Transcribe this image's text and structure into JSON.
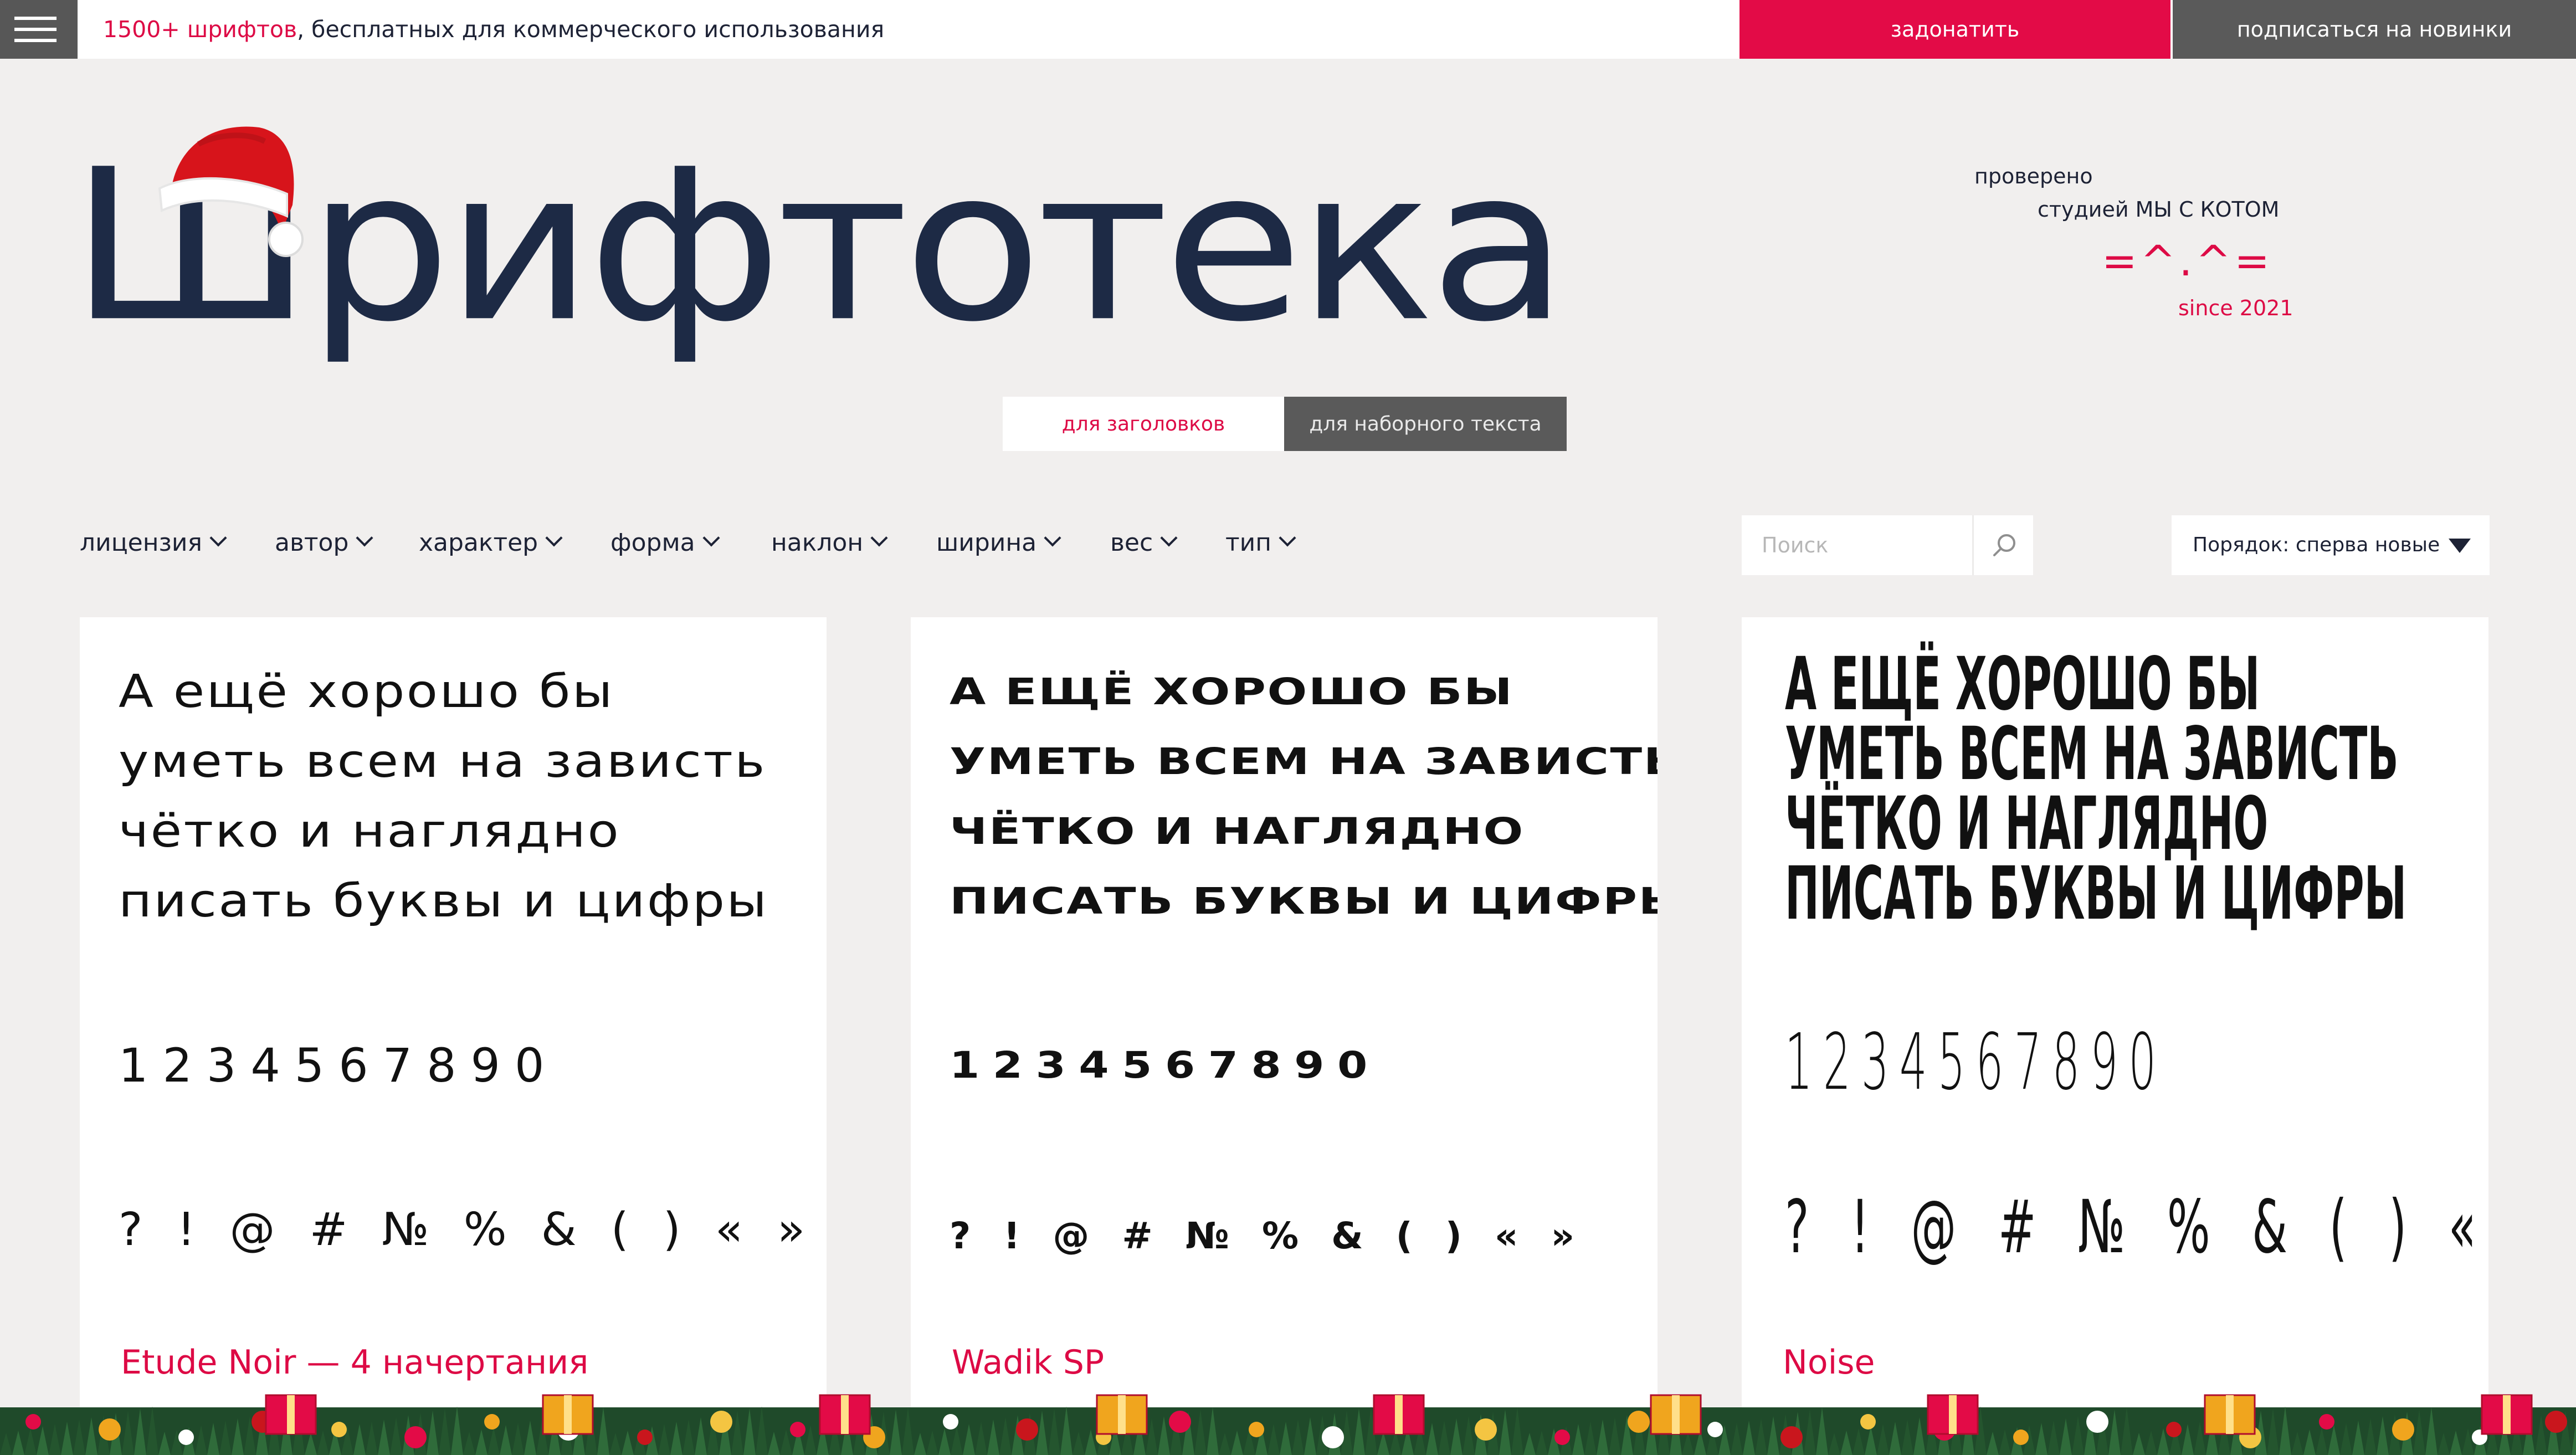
{
  "topbar": {
    "tagline_accent": "1500+ шрифтов",
    "tagline_rest": ", бесплатных для коммерческого использования",
    "donate_label": "задонатить",
    "subscribe_label": "подписаться на новинки"
  },
  "logo": {
    "text": "Шрифтотека"
  },
  "verified": {
    "line1": "проверено",
    "line2": "студией МЫ С КОТОМ",
    "cat": "=^.^=",
    "since": "since 2021"
  },
  "mode": {
    "headings_label": "для заголовков",
    "body_label": "для наборного текста"
  },
  "filters": [
    "лицензия",
    "автор",
    "характер",
    "форма",
    "наклон",
    "ширина",
    "вес",
    "тип"
  ],
  "search": {
    "placeholder": "Поиск"
  },
  "sort": {
    "label": "Порядок: сперва новые"
  },
  "cards": [
    {
      "lines": [
        "А ещё хорошо бы",
        "уметь всем на зависть",
        "чётко и наглядно",
        "писать буквы и цифры"
      ],
      "digits": "1234567890",
      "symbols": "? ! @ # № % & ( ) « »",
      "name": "Etude Noir — 4 начертания"
    },
    {
      "lines": [
        "А ещё хорошо бы",
        "уметь всем на зависть",
        "чётко и наглядно",
        "писать буквы и цифры"
      ],
      "digits": "1234567890",
      "symbols": "? ! @ # № % & ( ) « »",
      "name": "Wadik SP"
    },
    {
      "lines": [
        "А ещё хорошо бы",
        "уметь всем на зависть",
        "чётко и наглядно",
        "писать буквы и цифры"
      ],
      "digits": "1234567890",
      "symbols": "? ! @ # № % & ( ) « »",
      "name": "Noise"
    }
  ],
  "colors": {
    "accent": "#e30b47",
    "dark": "#1d2a45",
    "gray_button": "#5a5a5a",
    "background": "#f1efee"
  },
  "icons": [
    "menu-icon",
    "santa-hat-icon",
    "search-icon",
    "chevron-down-icon",
    "triangle-down-icon",
    "christmas-garland"
  ]
}
